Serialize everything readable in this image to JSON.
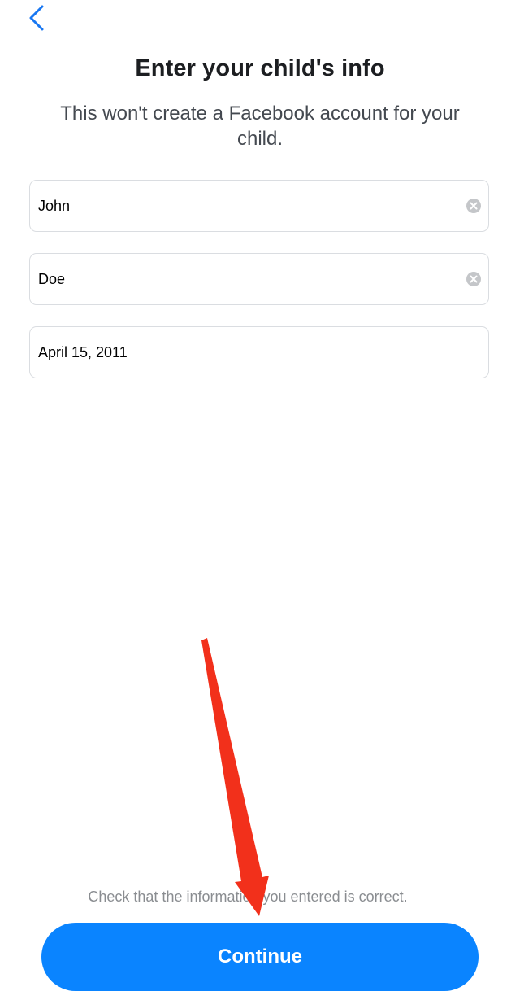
{
  "header": {
    "back_icon": "chevron-left-icon",
    "title": "Enter your child's info",
    "subtitle": "This won't create a Facebook account for your child."
  },
  "form": {
    "first_name": "John",
    "last_name": "Doe",
    "birthday": "April 15, 2011"
  },
  "footer": {
    "hint": "Check that the information you entered is correct.",
    "continue_label": "Continue"
  },
  "colors": {
    "accent": "#0a84ff",
    "annotation_arrow": "#f2301b"
  }
}
